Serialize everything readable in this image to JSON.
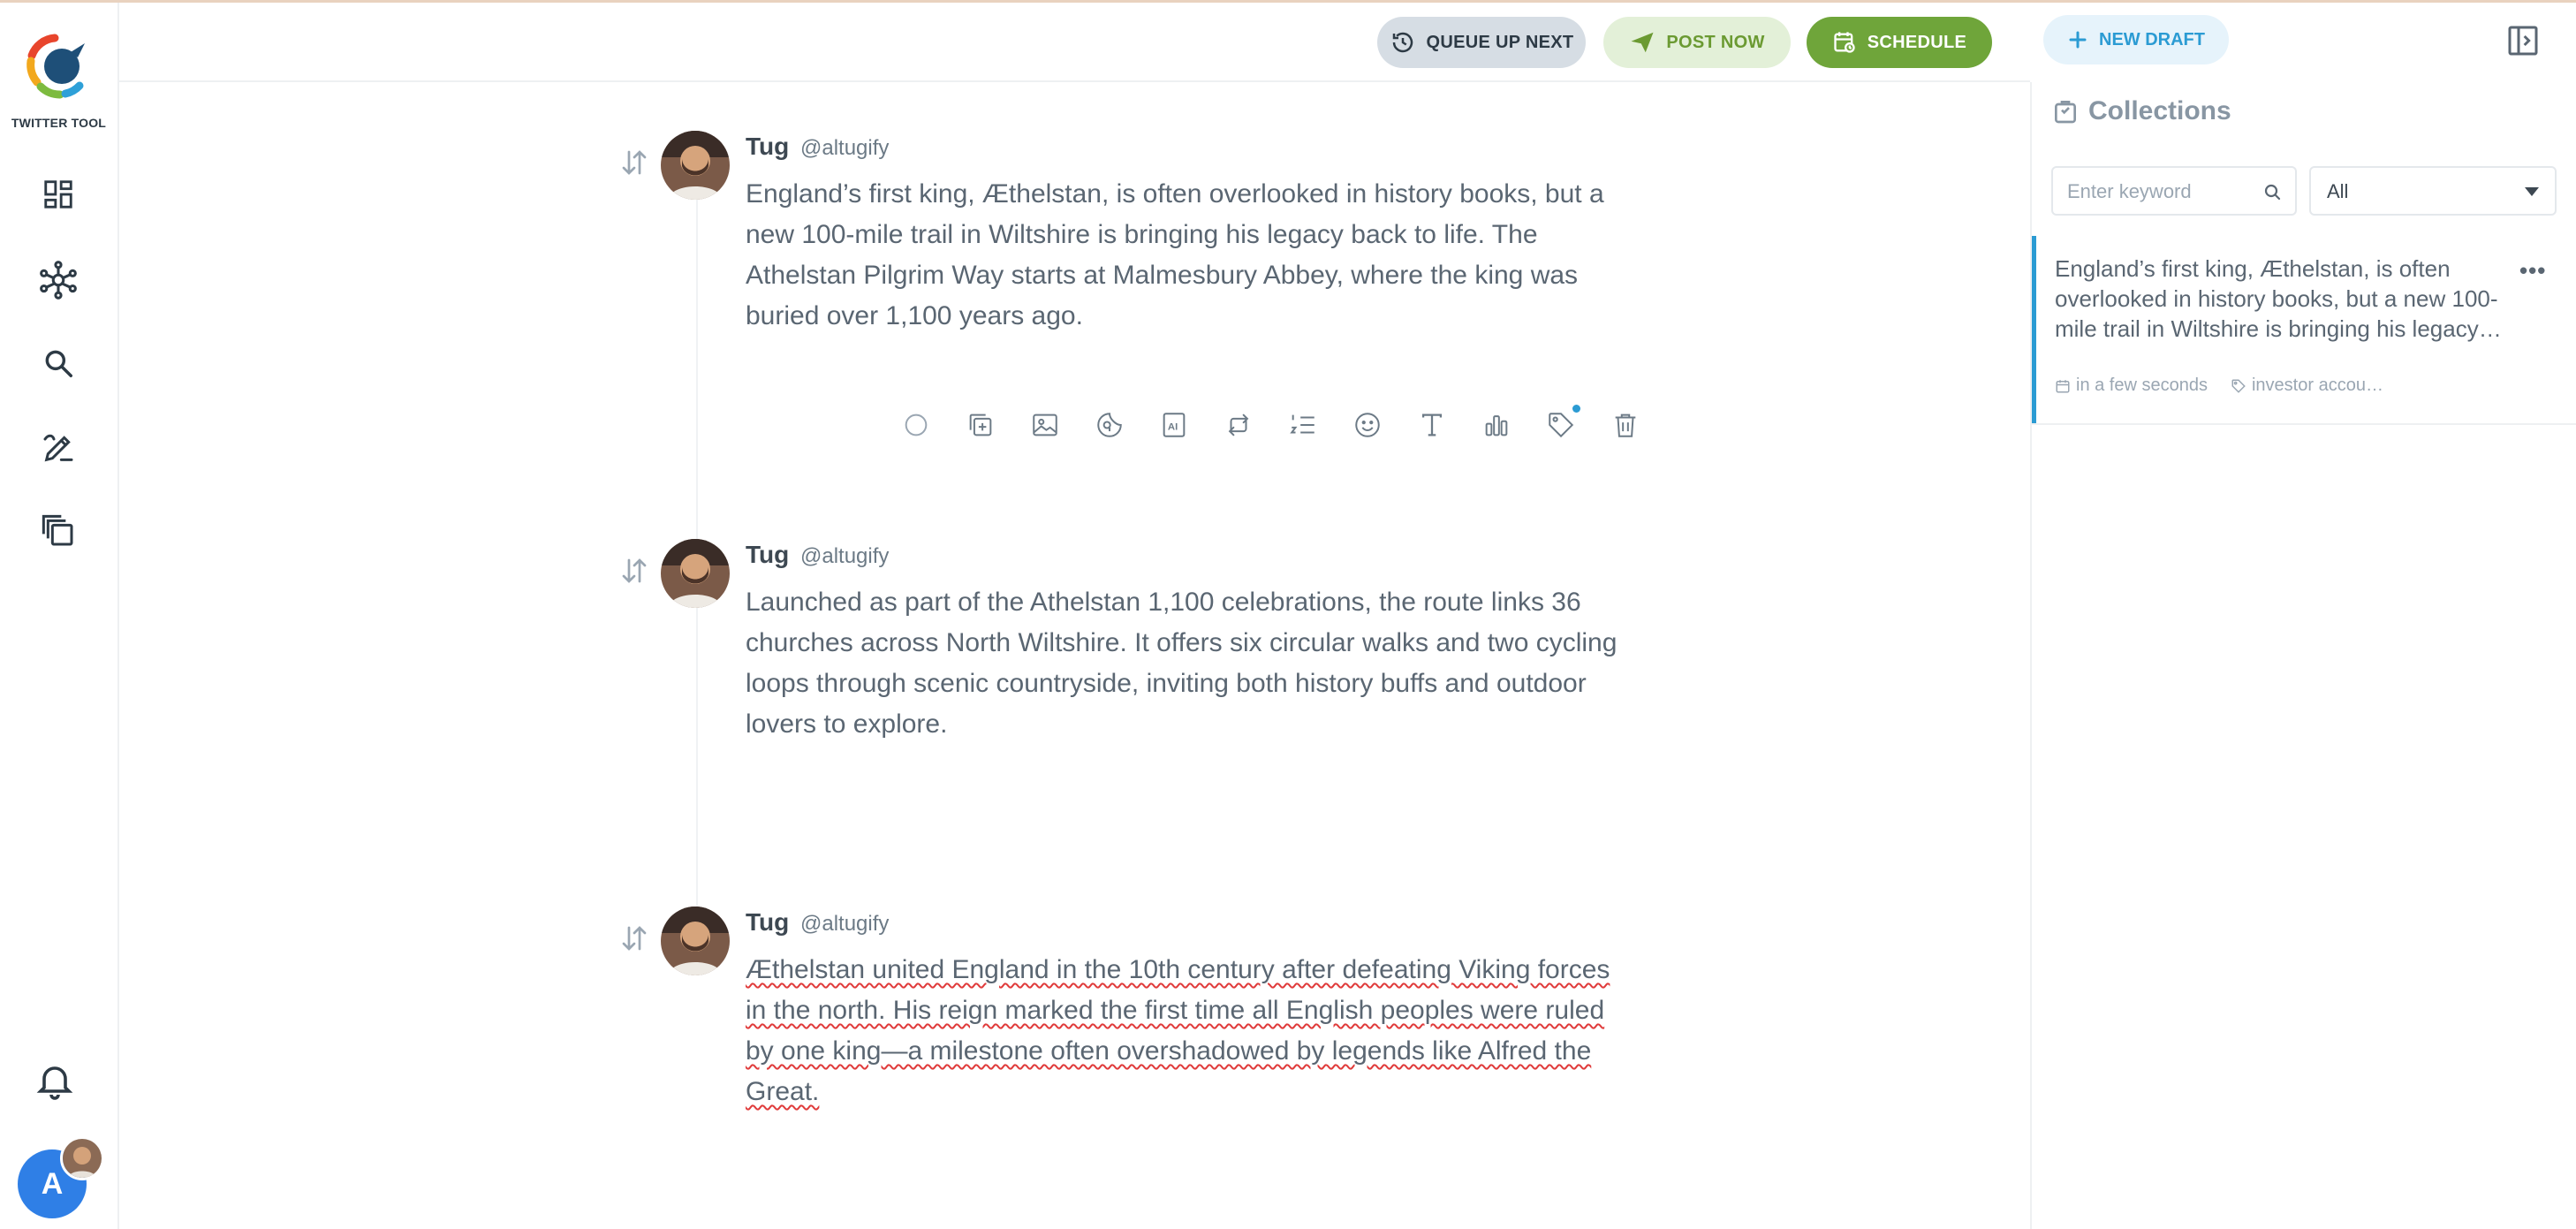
{
  "app": {
    "logo_text": "TWITTER TOOL"
  },
  "sidebar": {
    "items": [
      {
        "icon": "dashboard-icon"
      },
      {
        "icon": "network-icon"
      },
      {
        "icon": "search-icon"
      },
      {
        "icon": "compose-icon"
      },
      {
        "icon": "collections-icon"
      }
    ],
    "user_initial": "A"
  },
  "toolbar": {
    "queue_label": "QUEUE UP NEXT",
    "post_label": "POST NOW",
    "schedule_label": "SCHEDULE",
    "new_draft_label": "NEW DRAFT"
  },
  "thread": {
    "tweets": [
      {
        "name": "Tug",
        "handle": "@altugify",
        "text": "England’s first king, Æthelstan, is often overlooked in history books, but a new 100-mile trail in Wiltshire is bringing his legacy back to life. The Athelstan Pilgrim Way starts at Malmesbury Abbey, where the king was buried over 1,100 years ago."
      },
      {
        "name": "Tug",
        "handle": "@altugify",
        "text": "Launched as part of the Athelstan 1,100 celebrations, the route links 36 churches across North Wiltshire. It offers six circular walks and two cycling loops through scenic countryside, inviting both history buffs and outdoor lovers to explore."
      },
      {
        "name": "Tug",
        "handle": "@altugify",
        "text": "Æthelstan united England in the 10th century after defeating Viking forces in the north. His reign marked the first time all English peoples were ruled by one king—a milestone often overshadowed by legends like Alfred the Great."
      }
    ]
  },
  "collections": {
    "title": "Collections",
    "search_placeholder": "Enter keyword",
    "filter_value": "All",
    "card": {
      "text": "England’s first king, Æthelstan, is often overlooked in history books, but a new 100-mile trail in Wiltshire is bringing his legacy…",
      "schedule": "in a few seconds",
      "tag": "investor accou…"
    }
  },
  "colors": {
    "accent": "#2b9bd3",
    "schedule_green": "#6fa53a",
    "post_green_bg": "#e3f0d8",
    "queue_bg": "#d6dde4",
    "user_avatar": "#2f7fe6"
  }
}
